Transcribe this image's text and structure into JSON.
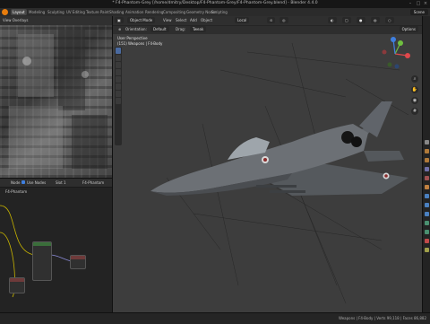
{
  "window": {
    "title": "* F4-Phantom-Grey [/home/dmitry/Desktop/F4-Phantom-Grey/F4-Phantom-Grey.blend] - Blender 4.4.0"
  },
  "menubar": {
    "workspaces": [
      "Layout",
      "Modeling",
      "Sculpting",
      "UV Editing",
      "Texture Paint",
      "Shading",
      "Animation",
      "Rendering",
      "Compositing",
      "Geometry Nodes",
      "Scripting"
    ],
    "active_workspace": "Layout",
    "scene_label": "Scene"
  },
  "image_editor": {
    "header_label": "View  Overlays"
  },
  "node_editor": {
    "header": {
      "node_label": "Node",
      "use_nodes_label": "Use Nodes",
      "slot_label": "Slot 1",
      "material_label": "F4-Phantom"
    },
    "subheader": "F4-Phantom"
  },
  "viewport": {
    "header": {
      "mode": "Object Mode",
      "menus": [
        "View",
        "Select",
        "Add",
        "Object"
      ],
      "transform_orientation": "Local",
      "options_label": "Options"
    },
    "toolbar": {
      "orientation_label": "Orientation:",
      "default_label": "Default",
      "drag_label": "Drag:",
      "tweak_label": "Tweak"
    },
    "info_line1": "User Perspective",
    "info_line2": "(151) Weapons | F4-Body",
    "gizmo_axes": [
      "X",
      "Y",
      "Z"
    ]
  },
  "statusbar": {
    "text": "Weapons | F4-Body | Verts 99,118 | Faces 86,882"
  },
  "colors": {
    "accent_red": "#e0484c",
    "accent_green": "#6fbf3f",
    "accent_blue": "#3f7fdf",
    "active_tab": "#474747"
  },
  "icons": [
    "blender-logo-icon",
    "zoom-icon",
    "hand-icon",
    "camera-icon",
    "grid-icon"
  ]
}
